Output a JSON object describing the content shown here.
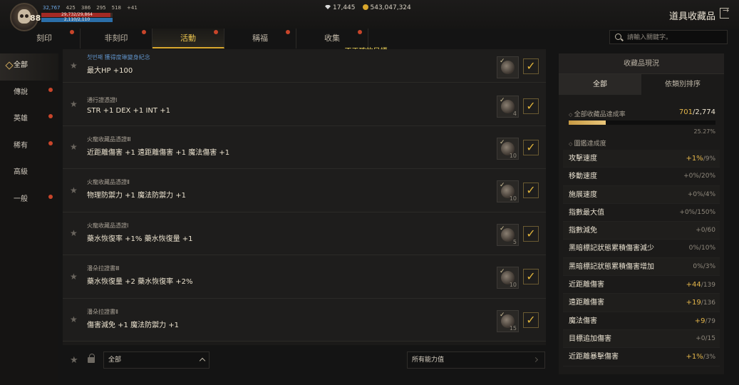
{
  "player": {
    "level": "88",
    "stats": [
      "32,767",
      "425",
      "386",
      "295",
      "518",
      "+41"
    ],
    "hp": "29,732/29,864",
    "mp": "2,110/2,110"
  },
  "currency": {
    "gems": "17,445",
    "gold": "543,047,324"
  },
  "page_title": "道具收藏品",
  "tabs": [
    {
      "label": "刻印",
      "dot": true,
      "active": false
    },
    {
      "label": "非刻印",
      "dot": true,
      "active": false
    },
    {
      "label": "活動",
      "dot": true,
      "active": true
    },
    {
      "label": "稱福",
      "dot": true,
      "active": false
    },
    {
      "label": "收集",
      "dot": true,
      "active": false
    }
  ],
  "error_message": "不正確的目標。",
  "search": {
    "placeholder": "請輸入關鍵字。",
    "value": ""
  },
  "sidebar": {
    "items": [
      {
        "label": "全部",
        "dot": false,
        "active": true
      },
      {
        "label": "傳說",
        "dot": true,
        "active": false
      },
      {
        "label": "英雄",
        "dot": true,
        "active": false
      },
      {
        "label": "稀有",
        "dot": true,
        "active": false
      },
      {
        "label": "高級",
        "dot": false,
        "active": false
      },
      {
        "label": "一般",
        "dot": true,
        "active": false
      }
    ]
  },
  "list": {
    "rows": [
      {
        "subtitle": "첫번째 獲得度琳變身紀念",
        "subtitle_blue": true,
        "title": "最大HP +100",
        "count": ""
      },
      {
        "subtitle": "通行證憑證I",
        "subtitle_blue": false,
        "title": "STR +1 DEX +1 INT +1",
        "count": "4"
      },
      {
        "subtitle": "火龍收藏品憑證Ⅲ",
        "subtitle_blue": false,
        "title": "近距離傷害 +1 遠距離傷害 +1 魔法傷害 +1",
        "count": "10"
      },
      {
        "subtitle": "火龍收藏品憑證Ⅱ",
        "subtitle_blue": false,
        "title": "物理防禦力 +1 魔法防禦力 +1",
        "count": "10"
      },
      {
        "subtitle": "火龍收藏品憑證Ⅰ",
        "subtitle_blue": false,
        "title": "藥水恢復率 +1% 藥水恢復量 +1",
        "count": "5"
      },
      {
        "subtitle": "潘朵拉證書Ⅲ",
        "subtitle_blue": false,
        "title": "藥水恢復量 +2 藥水恢復率 +2%",
        "count": "10"
      },
      {
        "subtitle": "潘朵拉證書Ⅱ",
        "subtitle_blue": false,
        "title": "傷害減免 +1 魔法防禦力 +1",
        "count": "15"
      }
    ]
  },
  "bottom": {
    "category_select": "全部",
    "stat_select": "所有能力值"
  },
  "panel": {
    "title": "收藏品現況",
    "subtabs": [
      "全部",
      "依類別排序"
    ],
    "rate_label": "全部收藏品達成率",
    "rate_current": "701",
    "rate_total": "2,774",
    "rate_progress": 0.2527,
    "percent": "25.27%",
    "section_label": "圖鑑達成度",
    "stats": [
      {
        "name": "攻擊速度",
        "cur": "+1%",
        "max": "/9%",
        "hi": true
      },
      {
        "name": "移動速度",
        "cur": "+0%",
        "max": "/20%",
        "hi": false
      },
      {
        "name": "施展速度",
        "cur": "+0%",
        "max": "/4%",
        "hi": false
      },
      {
        "name": "指數最大值",
        "cur": "+0%",
        "max": "/150%",
        "hi": false
      },
      {
        "name": "指數減免",
        "cur": "+0",
        "max": "/60",
        "hi": false
      },
      {
        "name": "黑暗標記狀態累積傷害減少",
        "cur": "0%",
        "max": "/10%",
        "hi": false
      },
      {
        "name": "黑暗標記狀態累積傷害增加",
        "cur": "0%",
        "max": "/3%",
        "hi": false
      },
      {
        "name": "近距離傷害",
        "cur": "+44",
        "max": "/139",
        "hi": true
      },
      {
        "name": "遠距離傷害",
        "cur": "+19",
        "max": "/136",
        "hi": true
      },
      {
        "name": "魔法傷害",
        "cur": "+9",
        "max": "/79",
        "hi": true
      },
      {
        "name": "目標追加傷害",
        "cur": "+0",
        "max": "/15",
        "hi": false
      },
      {
        "name": "近距離暴擊傷害",
        "cur": "+1%",
        "max": "/3%",
        "hi": true
      }
    ]
  },
  "colors": {
    "accent": "#e4b64a",
    "notify_dot": "#c9452a",
    "error_text": "#f1d65a"
  }
}
